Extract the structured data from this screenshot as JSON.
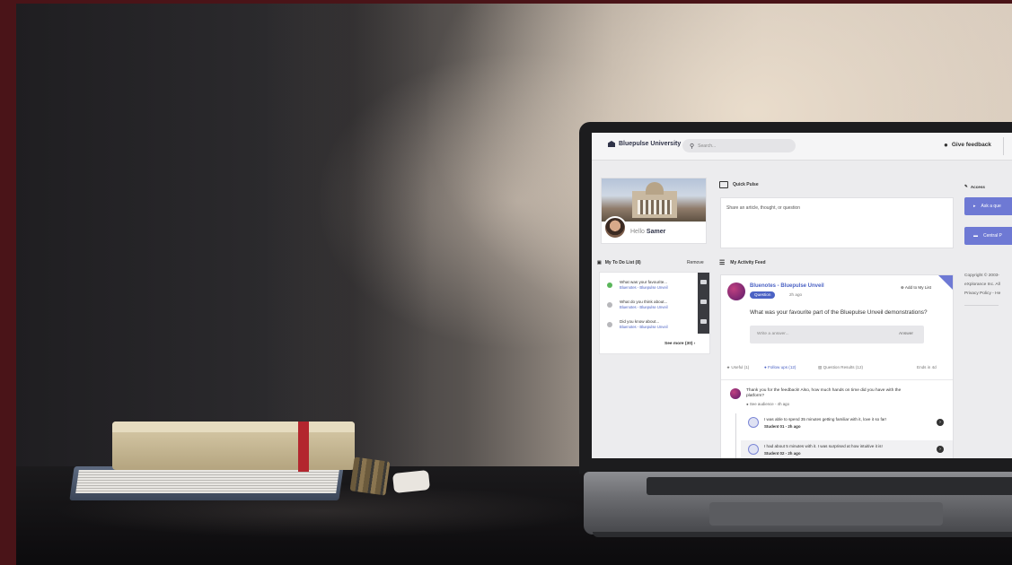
{
  "header": {
    "brand": "Bluepulse University",
    "search_placeholder": "Search...",
    "feedback_label": "Give feedback"
  },
  "profile": {
    "greeting": "Hello",
    "name": "Samer"
  },
  "todo": {
    "title": "My To Do List (8)",
    "remove_label": "Remove",
    "items": [
      {
        "title": "What was your favourite...",
        "source": "Bluenotes - Bluepulse Unveil",
        "done": true
      },
      {
        "title": "What do you think about...",
        "source": "Bluenotes - Bluepulse Unveil",
        "done": false
      },
      {
        "title": "Did you know about...",
        "source": "Bluenotes - Bluepulse Unveil",
        "done": false
      }
    ],
    "see_more": "See more (30)"
  },
  "quick_pulse": {
    "title": "Quick Pulse",
    "placeholder": "Share an article, thought, or question"
  },
  "access": {
    "title": "Access",
    "buttons": [
      "Ask a que",
      "Central P"
    ]
  },
  "footer": {
    "line1": "Copyright © 2003-",
    "line2": "eXplorance Inc. All",
    "line3": "Privacy Policy - He"
  },
  "feed": {
    "title": "My Activity Feed",
    "post": {
      "source": "Bluenotes - Bluepulse Unveil",
      "badge": "Question",
      "time": "2h ago",
      "add_label": "Add to My List",
      "question": "What was your favourite part of the Bluepulse Unveil demonstrations?",
      "answer_placeholder": "Write a answer...",
      "answer_button": "Answer"
    },
    "stats": {
      "useful": "Useful (1)",
      "followups": "Follow ups (12)",
      "results": "Question Results (12)",
      "ends": "Ends in 4d"
    },
    "comment": {
      "text": "Thank you for the feedback! Also, how much hands on time did you have with the platform?",
      "meta": "See audience - 4h ago"
    },
    "replies": [
      {
        "text": "I was able to spend 35 minutes getting familiar with it, love it so far!",
        "meta": "Student 01 - 2h ago"
      },
      {
        "text": "I had about 5 minutes with it. I was surprised at how intuitive it is!",
        "meta": "Student 02 - 2h ago"
      }
    ]
  },
  "icons": {
    "brand": "building-icon",
    "search": "search-icon",
    "feedback": "chat-bubbles-icon",
    "todo": "clipboard-icon",
    "quick_pulse": "chat-icon",
    "feed": "list-icon",
    "access": "pencil-icon",
    "megaphone": "megaphone-icon"
  },
  "colors": {
    "accent": "#6e79d4",
    "link": "#4b62c4",
    "done": "#5ab65a",
    "frame": "#4a1418"
  }
}
